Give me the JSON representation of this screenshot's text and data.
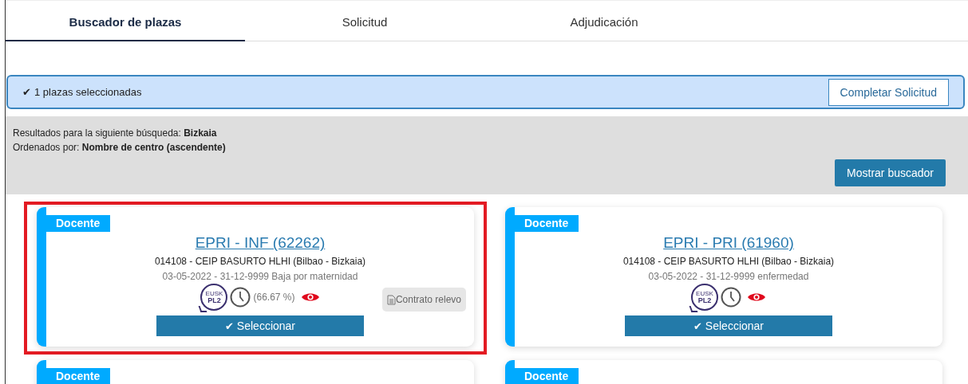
{
  "tabs": [
    {
      "label": "Buscador de plazas",
      "selected": true
    },
    {
      "label": "Solicitud",
      "selected": false
    },
    {
      "label": "Adjudicación",
      "selected": false
    }
  ],
  "selection_banner": {
    "check": "✔",
    "text": "1 plazas seleccionadas",
    "button": "Completar Solicitud"
  },
  "search_summary": {
    "lines": [
      "Resultados para la siguiente búsqueda: **Bizkaia**",
      "Ordenados por: **Nombre de centro (ascendente)**"
    ],
    "button": "Mostrar buscador"
  },
  "cards": [
    {
      "tag": "Docente",
      "highlighted": true,
      "title": "EPRI - INF (62262)",
      "center": "014108 - CEIP BASURTO HLHI (Bilbao - Bizkaia)",
      "dates": "03-05-2022 - 31-12-9999 Baja por maternidad",
      "language_badge": {
        "top": "EUSK",
        "bottom": "PL2"
      },
      "percentage": "(66.67 %)",
      "contract": "Contrato relevo",
      "check": "✔",
      "button": "Seleccionar"
    },
    {
      "tag": "Docente",
      "highlighted": false,
      "title": "EPRI - PRI (61960)",
      "center": "014108 - CEIP BASURTO HLHI (Bilbao - Bizkaia)",
      "dates": "03-05-2022 - 31-12-9999 enfermedad",
      "language_badge": {
        "top": "EUSK",
        "bottom": "PL2"
      },
      "check": "✔",
      "button": "Seleccionar"
    },
    {
      "tag": "Docente",
      "highlighted": false
    },
    {
      "tag": "Docente",
      "highlighted": false
    }
  ]
}
